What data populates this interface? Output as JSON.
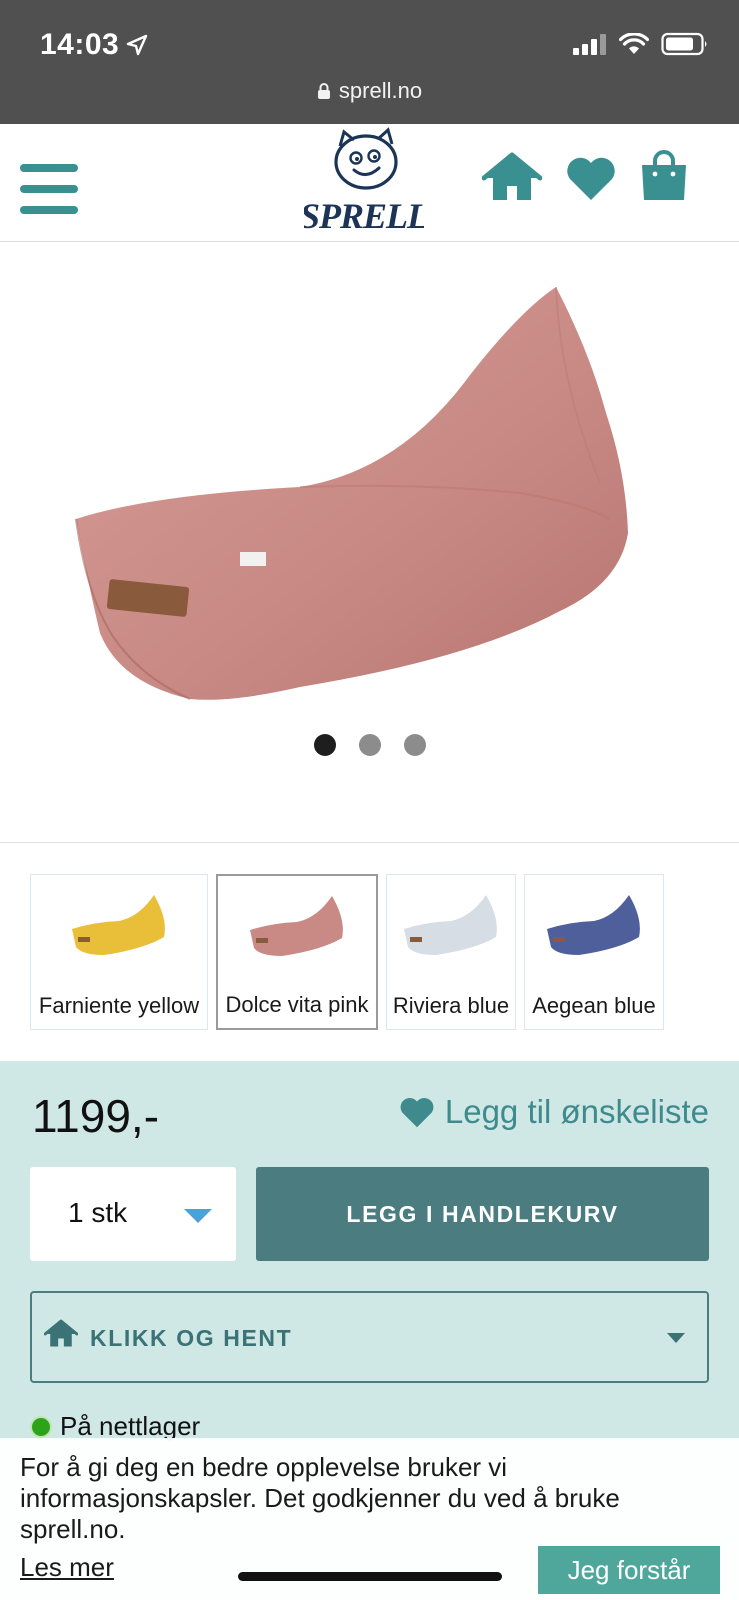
{
  "status_bar": {
    "time": "14:03",
    "url": "sprell.no",
    "icons": [
      "location-arrow-icon",
      "signal-icon",
      "wifi-icon",
      "battery-icon",
      "lock-icon"
    ]
  },
  "header": {
    "logo_text": "SPRELL",
    "icons": [
      "menu-icon",
      "home-icon",
      "heart-icon",
      "shopping-bag-icon"
    ],
    "accent_color": "#3a8f91"
  },
  "gallery": {
    "product_color": "#c98a85",
    "dot_count": 3,
    "active_dot": 0
  },
  "variants": [
    {
      "label": "Farniente yellow",
      "color": "#e9bf3a",
      "selected": false
    },
    {
      "label": "Dolce vita pink",
      "color": "#c98a85",
      "selected": true
    },
    {
      "label": "Riviera blue",
      "color": "#d7dde4",
      "selected": false
    },
    {
      "label": "Aegean blue",
      "color": "#4f5f9c",
      "selected": false
    }
  ],
  "purchase": {
    "price": "1199,-",
    "wishlist_label": "Legg til ønskeliste",
    "quantity_value": "1 stk",
    "add_to_cart_label": "LEGG I HANDLEKURV",
    "pickup_label": "KLIKK OG HENT",
    "stock_label": "På nettlager",
    "panel_color": "#cfe8e5",
    "button_color": "#4a7c80"
  },
  "cookie": {
    "text": "For å gi deg en bedre opplevelse bruker vi informasjonskapsler. Det godkjenner du ved å bruke sprell.no.",
    "more_label": "Les mer",
    "accept_label": "Jeg forstår",
    "accept_color": "#4fa79b"
  }
}
